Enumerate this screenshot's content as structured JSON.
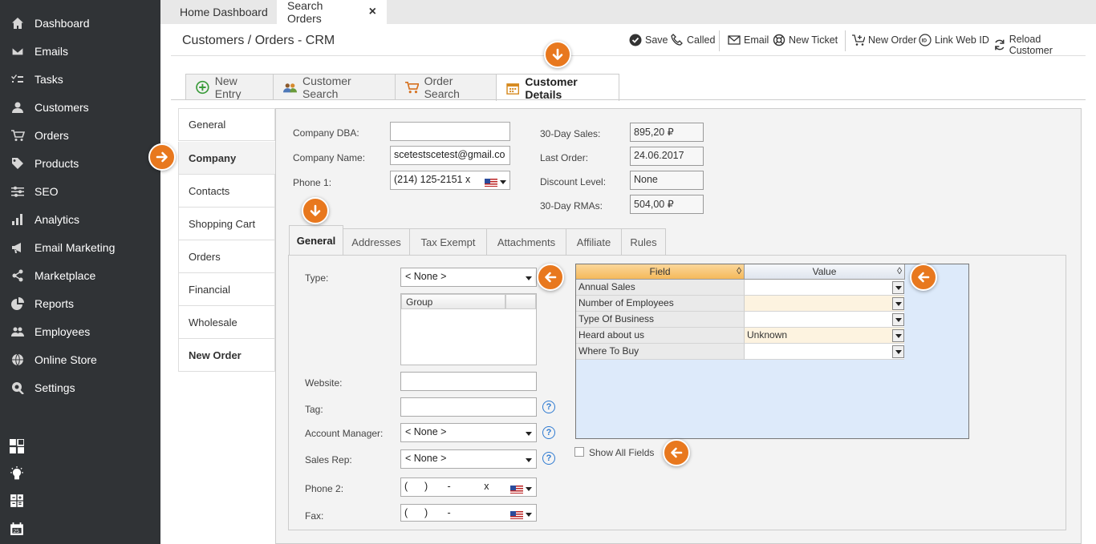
{
  "sidebar": {
    "items": [
      {
        "label": "Dashboard",
        "icon": "home-icon"
      },
      {
        "label": "Emails",
        "icon": "mail-icon"
      },
      {
        "label": "Tasks",
        "icon": "tasks-icon"
      },
      {
        "label": "Customers",
        "icon": "user-icon"
      },
      {
        "label": "Orders",
        "icon": "cart-icon"
      },
      {
        "label": "Products",
        "icon": "tag-icon"
      },
      {
        "label": "SEO",
        "icon": "sliders-icon"
      },
      {
        "label": "Analytics",
        "icon": "bar-chart-icon"
      },
      {
        "label": "Email Marketing",
        "icon": "megaphone-icon"
      },
      {
        "label": "Marketplace",
        "icon": "share-icon"
      },
      {
        "label": "Reports",
        "icon": "pie-chart-icon"
      },
      {
        "label": "Employees",
        "icon": "users-icon"
      },
      {
        "label": "Online Store",
        "icon": "globe-icon"
      },
      {
        "label": "Settings",
        "icon": "gear-icon"
      }
    ],
    "bottom_icons": [
      "layout-icon",
      "lightbulb-icon",
      "calculator-icon",
      "calendar-icon"
    ]
  },
  "top_tabs": [
    {
      "label": "Home Dashboard"
    },
    {
      "label": "Search Orders",
      "close": "×"
    }
  ],
  "header": {
    "title": "Customers / Orders - CRM",
    "toolbar": {
      "save": "Save",
      "called": "Called",
      "email": "Email",
      "new_ticket": "New Ticket",
      "new_order": "New Order",
      "link_web_id": "Link Web ID",
      "reload_customer": "Reload Customer"
    }
  },
  "content_tabs": [
    {
      "label": "New Entry"
    },
    {
      "label": "Customer Search"
    },
    {
      "label": "Order Search"
    },
    {
      "label": "Customer Details"
    }
  ],
  "left_nav": [
    "General",
    "Company",
    "Contacts",
    "Shopping Cart",
    "Orders",
    "Financial",
    "Wholesale",
    "New Order"
  ],
  "company": {
    "dba_label": "Company DBA:",
    "dba_value": "",
    "name_label": "Company Name:",
    "name_value": "scetestscetest@gmail.co",
    "phone1_label": "Phone 1:",
    "phone1_value": "(214) 125-2151 x",
    "sales_label": "30-Day Sales:",
    "sales_value": "895,20 ₽",
    "last_order_label": "Last Order:",
    "last_order_value": "24.06.2017",
    "discount_label": "Discount Level:",
    "discount_value": "None",
    "rma_label": "30-Day RMAs:",
    "rma_value": "504,00 ₽"
  },
  "inner_tabs": [
    "General",
    "Addresses",
    "Tax Exempt",
    "Attachments",
    "Affiliate",
    "Rules"
  ],
  "general": {
    "type_label": "Type:",
    "type_value": "< None >",
    "group_header": "Group",
    "website_label": "Website:",
    "tag_label": "Tag:",
    "account_manager_label": "Account Manager:",
    "account_manager_value": "< None >",
    "sales_rep_label": "Sales Rep:",
    "sales_rep_value": "< None >",
    "phone2_label": "Phone 2:",
    "phone2_value": "(      )       -            x",
    "fax_label": "Fax:",
    "fax_value": "(      )       -",
    "help": "?"
  },
  "fields_grid": {
    "headers": [
      "Field",
      "Value"
    ],
    "sort_glyph": "◊",
    "rows": [
      {
        "field": "Annual Sales",
        "value": ""
      },
      {
        "field": "Number of Employees",
        "value": ""
      },
      {
        "field": "Type Of Business",
        "value": ""
      },
      {
        "field": "Heard about us",
        "value": "Unknown"
      },
      {
        "field": "Where To Buy",
        "value": ""
      }
    ],
    "show_all_label": "Show All Fields"
  },
  "colors": {
    "sidebar": "#303336",
    "accent": "#e8781e",
    "grid_header": "#f8c477",
    "grid_bg": "#ddeafa"
  }
}
